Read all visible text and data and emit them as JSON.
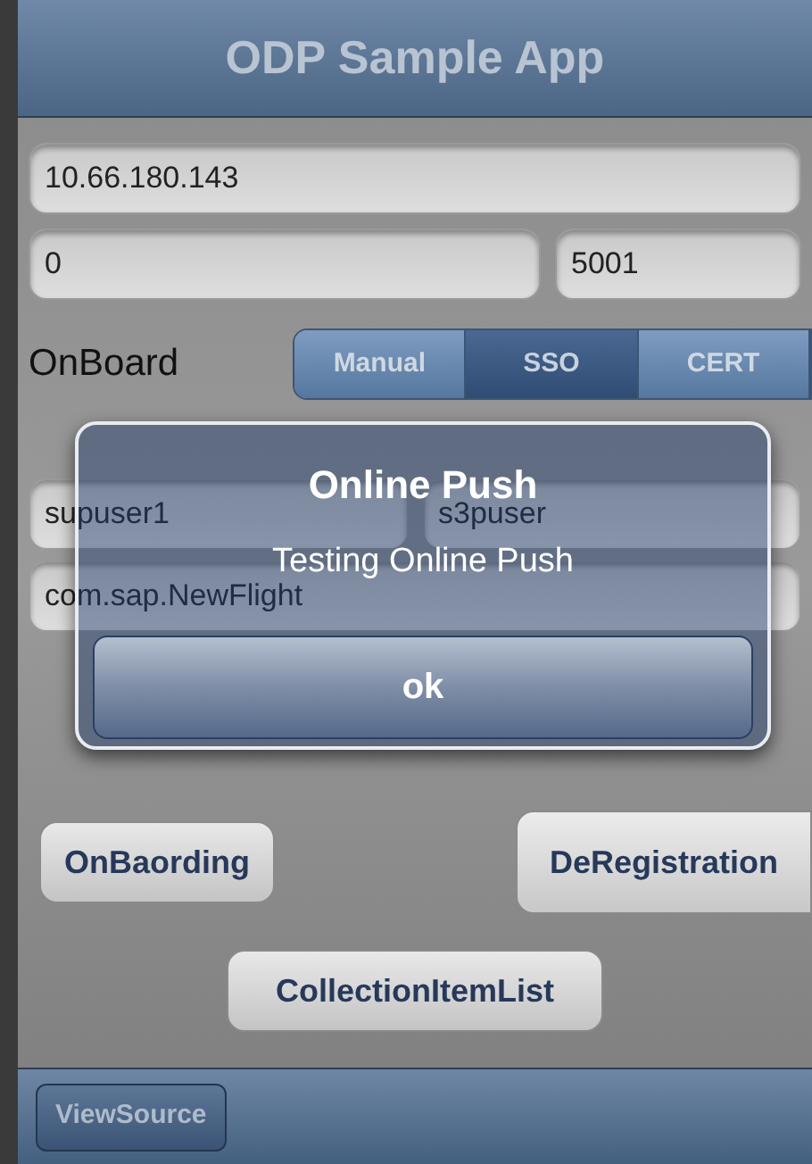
{
  "nav_bar": {
    "title": "ODP Sample App"
  },
  "host_field": {
    "value": "10.66.180.143"
  },
  "port_row": [
    {
      "value": "0"
    },
    {
      "value": "5001"
    }
  ],
  "onboard": {
    "label": "OnBoard",
    "options": [
      {
        "label": "Manual",
        "selected": false
      },
      {
        "label": "SSO",
        "selected": true
      },
      {
        "label": "CERT",
        "selected": false
      }
    ]
  },
  "user_row": [
    {
      "value": "supuser1"
    },
    {
      "value": "s3puser"
    }
  ],
  "app_field": {
    "value": "com.sap.NewFlight"
  },
  "buttons": [
    {
      "label": "OnBaording"
    },
    {
      "label": "DeRegistration"
    },
    {
      "label": "CollectionItemList"
    }
  ],
  "toolbar": {
    "button": "ViewSource"
  },
  "alert": {
    "title": "Online Push",
    "message": "Testing Online Push",
    "button": "ok"
  }
}
